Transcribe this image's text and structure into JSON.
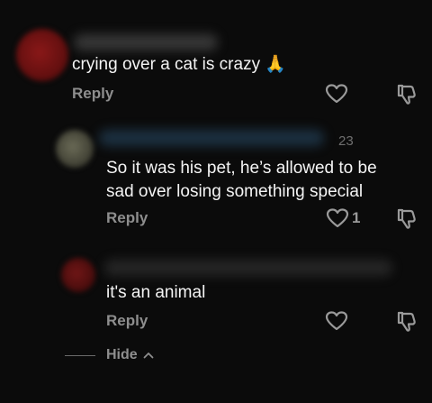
{
  "comments": [
    {
      "text": "crying over a cat is crazy 🙏",
      "reply_label": "Reply",
      "like_count": "",
      "timestamp": "",
      "avatar_color": "#7a1414"
    },
    {
      "text": "So it was his pet, he’s allowed to be\nsad over losing something special",
      "reply_label": "Reply",
      "like_count": "1",
      "timestamp": "23",
      "avatar_color": "#5a5a48"
    },
    {
      "text": "it's an animal",
      "reply_label": "Reply",
      "like_count": "",
      "timestamp": "",
      "avatar_color": "#5a1212"
    }
  ],
  "replies_toggle": {
    "label": "Hide",
    "chevron": "^"
  },
  "icons": {
    "like": "heart-icon",
    "dislike": "thumbs-down-icon",
    "collapse": "chevron-up-icon"
  },
  "colors": {
    "background": "#0b0b0b",
    "text": "#f4f4f4",
    "muted": "#8e8e8e"
  }
}
